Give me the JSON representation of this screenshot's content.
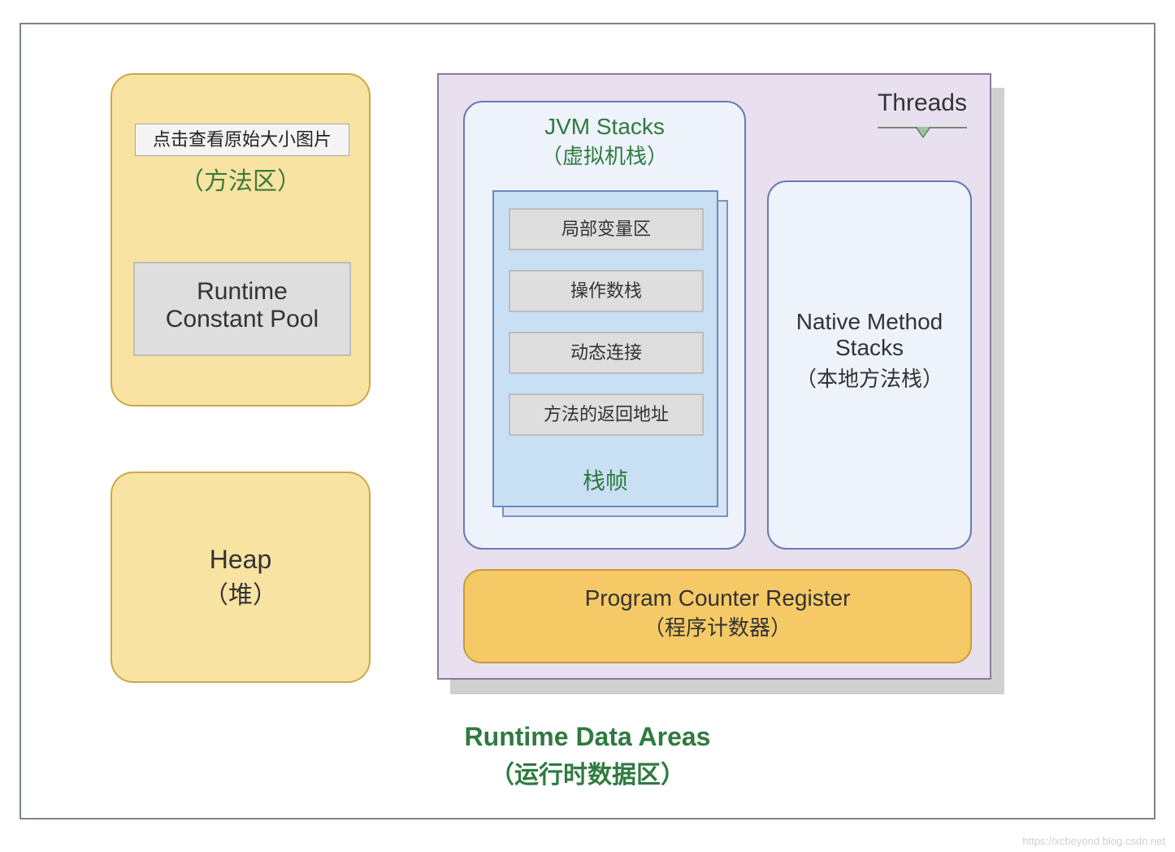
{
  "tooltip": "点击查看原始大小图片",
  "methodArea": {
    "subtitle": "（方法区）"
  },
  "constantPool": {
    "l1": "Runtime",
    "l2": "Constant Pool"
  },
  "heap": {
    "l1": "Heap",
    "l2": "（堆）"
  },
  "threads": {
    "label": "Threads"
  },
  "jvmStacks": {
    "title": "JVM Stacks",
    "subtitle": "（虚拟机栈）",
    "frameLabel": "栈帧",
    "slots": [
      "局部变量区",
      "操作数栈",
      "动态连接",
      "方法的返回地址"
    ]
  },
  "nativeStacks": {
    "l1": "Native Method",
    "l2": "Stacks",
    "l3": "（本地方法栈）"
  },
  "pcRegister": {
    "l1": "Program Counter Register",
    "l2": "（程序计数器）"
  },
  "mainTitle": {
    "l1": "Runtime Data Areas",
    "l2": "（运行时数据区）"
  },
  "watermark": "https://xcbeyond.blog.csdn.net"
}
